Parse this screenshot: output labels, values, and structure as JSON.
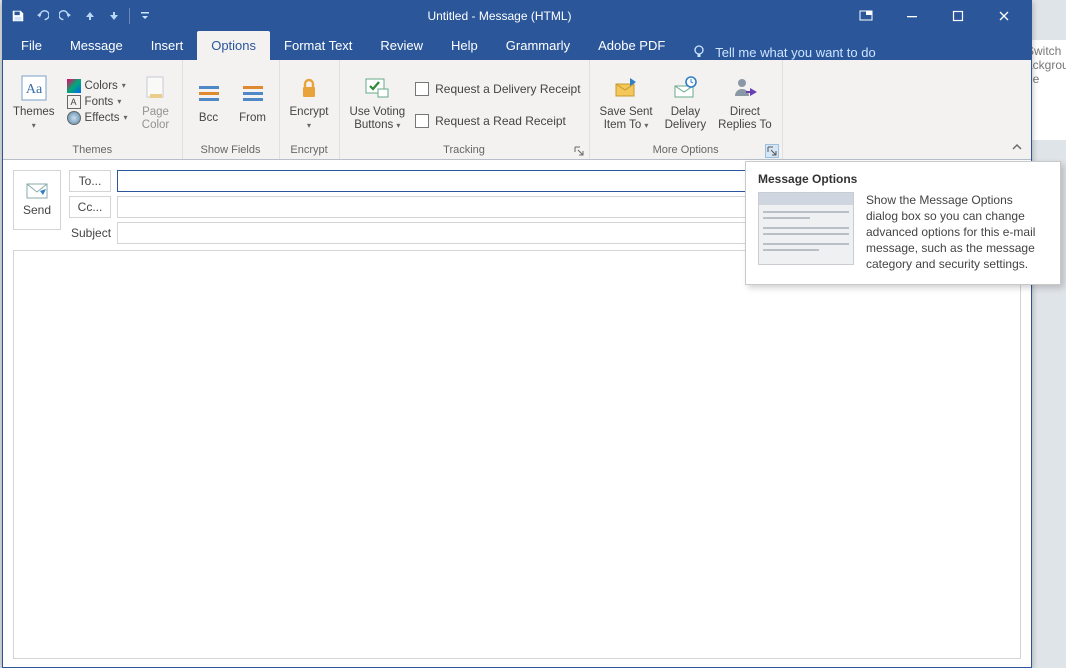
{
  "titlebar": {
    "title": "Untitled  -  Message (HTML)"
  },
  "qat": {
    "save": "save",
    "undo": "undo",
    "redo": "redo",
    "up": "up",
    "down": "down",
    "customize": "customize"
  },
  "tabs": {
    "file": "File",
    "message": "Message",
    "insert": "Insert",
    "options": "Options",
    "format_text": "Format Text",
    "review": "Review",
    "help": "Help",
    "grammarly": "Grammarly",
    "adobe_pdf": "Adobe PDF",
    "tellme": "Tell me what you want to do"
  },
  "ribbon": {
    "themes": {
      "themes_btn": "Themes",
      "colors": "Colors",
      "fonts": "Fonts",
      "effects": "Effects",
      "page_color": "Page\nColor",
      "group_label": "Themes"
    },
    "show_fields": {
      "bcc": "Bcc",
      "from": "From",
      "group_label": "Show Fields"
    },
    "encrypt": {
      "encrypt": "Encrypt",
      "group_label": "Encrypt"
    },
    "tracking": {
      "voting": "Use Voting\nButtons",
      "delivery_receipt": "Request a Delivery Receipt",
      "read_receipt": "Request a Read Receipt",
      "group_label": "Tracking"
    },
    "more_options": {
      "save_sent": "Save Sent\nItem To",
      "delay": "Delay\nDelivery",
      "direct": "Direct\nReplies To",
      "group_label": "More Options"
    }
  },
  "compose": {
    "send": "Send",
    "to_label": "To...",
    "cc_label": "Cc...",
    "subject_label": "Subject",
    "to_value": "",
    "cc_value": "",
    "subject_value": "",
    "body_value": ""
  },
  "callout": {
    "title": "Message Options",
    "text": "Show the Message Options dialog box so you can change advanced options for this e-mail message, such as the message category and security settings."
  },
  "bg": {
    "l1": "Switch",
    "l2": "ackgroun",
    "l3": "de"
  }
}
